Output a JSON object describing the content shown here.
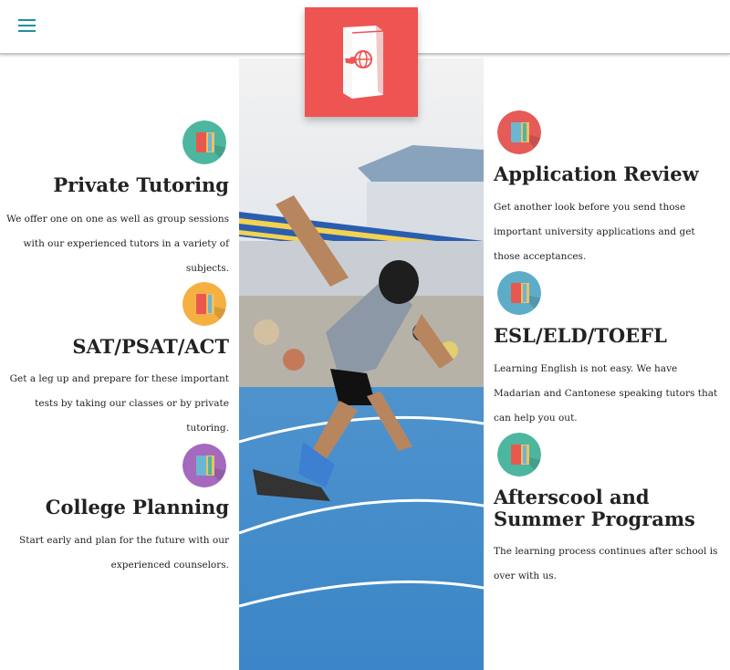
{
  "header": {
    "menu_icon": "hamburger-menu-icon",
    "logo_icon": "book-globe-logo-icon",
    "accent_color": "#1f8fa0",
    "logo_color": "#ee5452"
  },
  "hero_image": {
    "description_icon": "sprinter-photo"
  },
  "services_left": [
    {
      "icon": "book-icon",
      "icon_color": "#4db6a0",
      "title": "Private Tutoring",
      "description": "We offer one on one as well as group sessions with our experienced tutors in a variety of subjects."
    },
    {
      "icon": "book-icon",
      "icon_color": "#f5b041",
      "title": "SAT/PSAT/ACT",
      "description": "Get a leg up and prepare for these important tests by taking our classes or by private tutoring."
    },
    {
      "icon": "book-icon",
      "icon_color": "#a569bd",
      "title": "College Planning",
      "description": "Start early and plan for the future with our experienced counselors."
    }
  ],
  "services_right": [
    {
      "icon": "book-icon",
      "icon_color": "#e55b57",
      "title": "Application Review",
      "description": "Get another look before you send those important university applications and get those acceptances."
    },
    {
      "icon": "book-icon",
      "icon_color": "#5dadc8",
      "title": "ESL/ELD/TOEFL",
      "description": "Learning English is not easy. We have Madarian and Cantonese speaking tutors that can help you out."
    },
    {
      "icon": "book-icon",
      "icon_color": "#4db6a0",
      "title": "Afterscool and Summer Programs",
      "description": "The learning process continues after school is over with us."
    }
  ]
}
